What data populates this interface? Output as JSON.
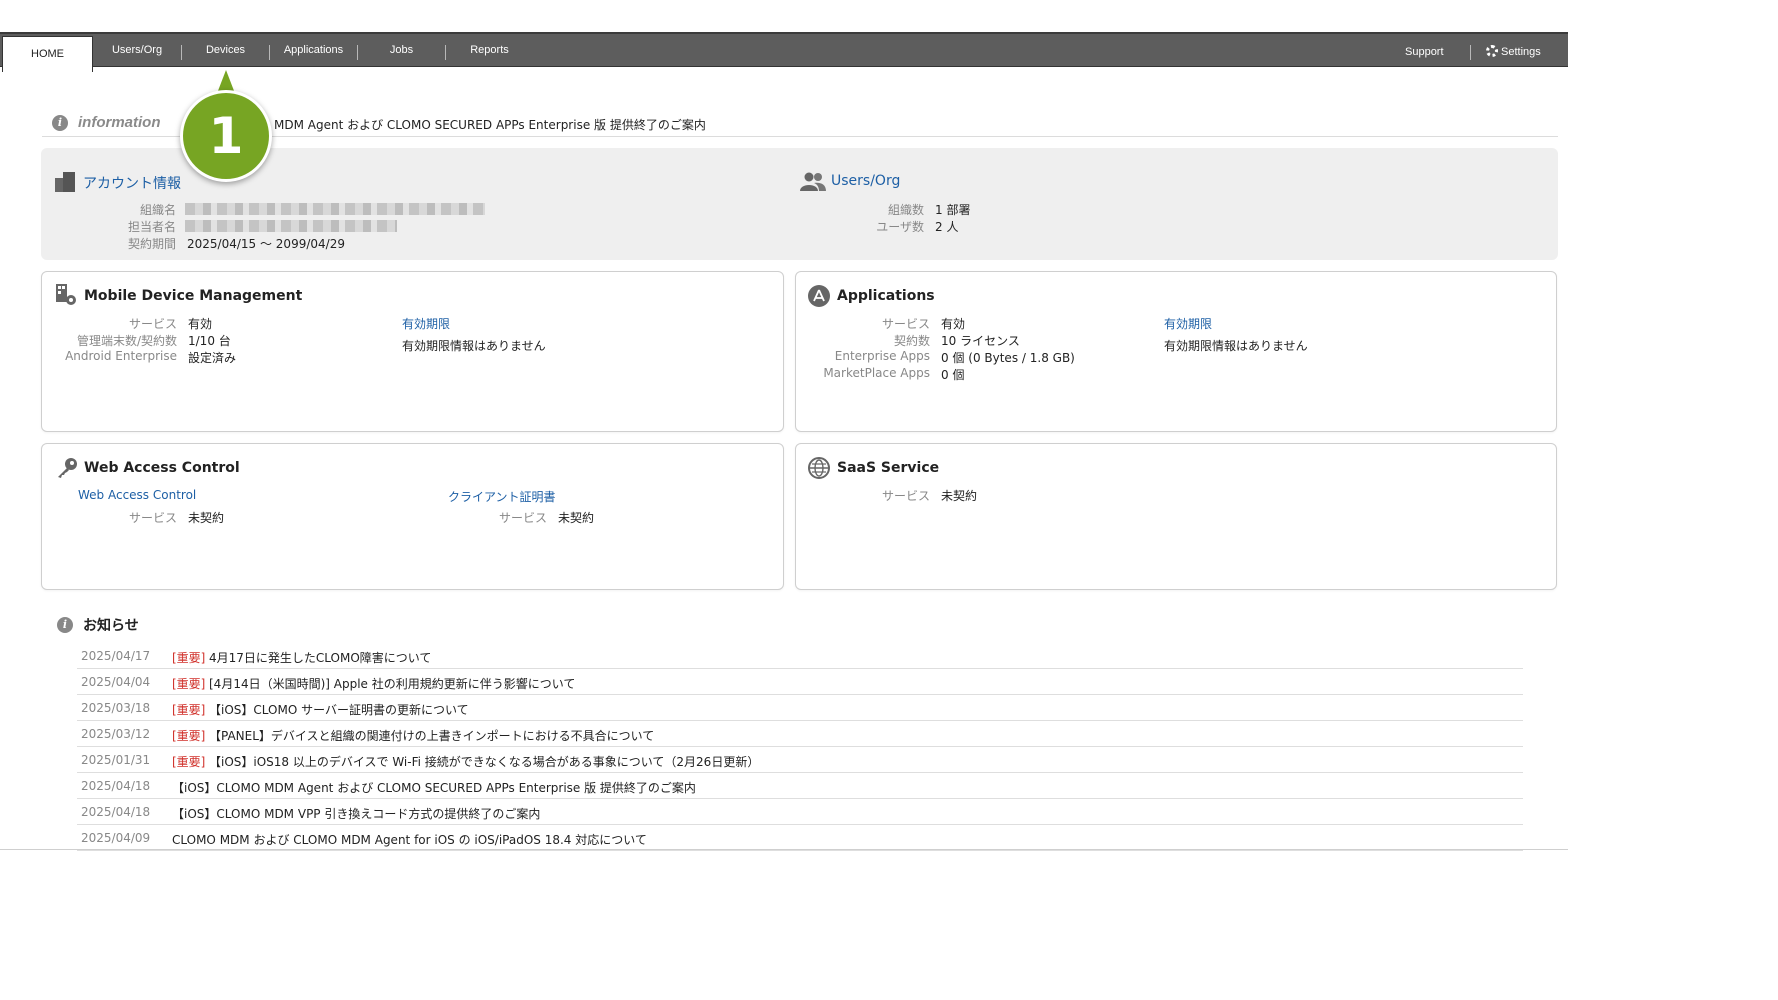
{
  "nav": {
    "tabs": [
      {
        "label": "HOME"
      },
      {
        "label": "Users/Org"
      },
      {
        "label": "Devices"
      },
      {
        "label": "Applications"
      },
      {
        "label": "Jobs"
      },
      {
        "label": "Reports"
      }
    ],
    "support": "Support",
    "settings": "Settings"
  },
  "callout": {
    "number": "1"
  },
  "information": {
    "label": "information",
    "text": "MDM Agent および CLOMO SECURED APPs Enterprise 版 提供終了のご案内"
  },
  "account": {
    "title": "アカウント情報",
    "org_label": "組織名",
    "person_label": "担当者名",
    "period_label": "契約期間",
    "period_value": "2025/04/15 ～ 2099/04/29"
  },
  "users_org": {
    "title": "Users/Org",
    "org_count_label": "組織数",
    "org_count_value": "1 部署",
    "user_count_label": "ユーザ数",
    "user_count_value": "2 人"
  },
  "mdm": {
    "title": "Mobile Device Management",
    "service_label": "サービス",
    "service_value": "有効",
    "devices_label": "管理端末数/契約数",
    "devices_value": "1/10 台",
    "android_label": "Android Enterprise",
    "android_value": "設定済み",
    "expiry_link": "有効期限",
    "expiry_text": "有効期限情報はありません"
  },
  "applications": {
    "title": "Applications",
    "service_label": "サービス",
    "service_value": "有効",
    "contract_label": "契約数",
    "contract_value": "10 ライセンス",
    "enterprise_label": "Enterprise Apps",
    "enterprise_value": "0 個 (0 Bytes / 1.8 GB)",
    "marketplace_label": "MarketPlace Apps",
    "marketplace_value": "0 個",
    "expiry_link": "有効期限",
    "expiry_text": "有効期限情報はありません"
  },
  "wac": {
    "title": "Web Access Control",
    "link1": "Web Access Control",
    "service1_label": "サービス",
    "service1_value": "未契約",
    "link2": "クライアント証明書",
    "service2_label": "サービス",
    "service2_value": "未契約"
  },
  "saas": {
    "title": "SaaS Service",
    "service_label": "サービス",
    "service_value": "未契約"
  },
  "news": {
    "title": "お知らせ",
    "items": [
      {
        "date": "2025/04/17",
        "tag": "[重要]",
        "text": "4月17日に発生したCLOMO障害について"
      },
      {
        "date": "2025/04/04",
        "tag": "[重要]",
        "text": "[4月14日（米国時間)] Apple 社の利用規約更新に伴う影響について"
      },
      {
        "date": "2025/03/18",
        "tag": "[重要]",
        "text": "【iOS】CLOMO サーバー証明書の更新について"
      },
      {
        "date": "2025/03/12",
        "tag": "[重要]",
        "text": "【PANEL】デバイスと組織の関連付けの上書きインポートにおける不具合について"
      },
      {
        "date": "2025/01/31",
        "tag": "[重要]",
        "text": "【iOS】iOS18 以上のデバイスで Wi-Fi 接続ができなくなる場合がある事象について（2月26日更新）"
      },
      {
        "date": "2025/04/18",
        "tag": "",
        "text": "【iOS】CLOMO MDM Agent および CLOMO SECURED APPs Enterprise 版 提供終了のご案内"
      },
      {
        "date": "2025/04/18",
        "tag": "",
        "text": "【iOS】CLOMO MDM VPP 引き換えコード方式の提供終了のご案内"
      },
      {
        "date": "2025/04/09",
        "tag": "",
        "text": "CLOMO MDM および CLOMO MDM Agent for iOS の iOS/iPadOS 18.4 対応について"
      }
    ]
  },
  "colors": {
    "nav_bg": "#5d5d5d",
    "link": "#1d5fa5",
    "important": "#d0302a",
    "callout": "#77a523"
  }
}
